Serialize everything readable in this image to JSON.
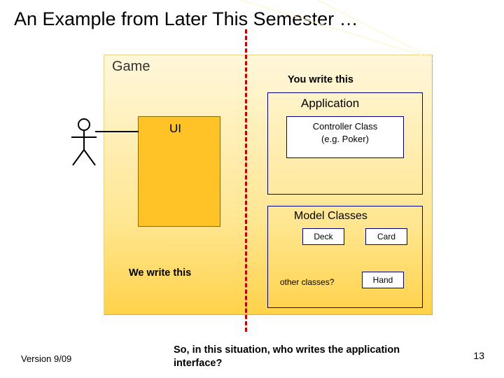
{
  "title": "An Example from Later This Semester …",
  "game_label": "Game",
  "you_write": "You write this",
  "we_write": "We write this",
  "app": {
    "label": "Application",
    "controller_line1": "Controller Class",
    "controller_line2": "(e.g. Poker)"
  },
  "ui_label": "UI",
  "model": {
    "label": "Model Classes",
    "deck": "Deck",
    "card": "Card",
    "hand": "Hand",
    "other": "other classes?"
  },
  "footer": {
    "version": "Version 9/09",
    "question": "So, in this situation, who writes the application interface?",
    "page": "13"
  }
}
